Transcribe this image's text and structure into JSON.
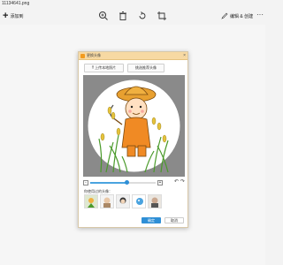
{
  "window": {
    "title": "11134641.png"
  },
  "toolbar": {
    "add_label": "添加到",
    "zoom_icon": "zoom-in-icon",
    "delete_icon": "trash-icon",
    "favorite_icon": "heart-icon",
    "rotate_icon": "rotate-icon",
    "crop_icon": "crop-icon",
    "edit_label": "编辑 & 创建",
    "more_label": "···"
  },
  "dialog": {
    "title": "更换头像",
    "close": "×",
    "upload_label": "上传本地照片",
    "recommend_label": "挑选推荐头像",
    "zoom_value": 0.55,
    "zoom_minus": "-",
    "zoom_plus": "+",
    "rotate_left": "↶",
    "rotate_right": "↷",
    "recent_label": "你使用过的头像：",
    "confirm_label": "确定",
    "cancel_label": "取消"
  },
  "colors": {
    "accent": "#2f8fd6",
    "title_bar": "#f7d9a3",
    "crop_background": "#8a8a8a"
  }
}
